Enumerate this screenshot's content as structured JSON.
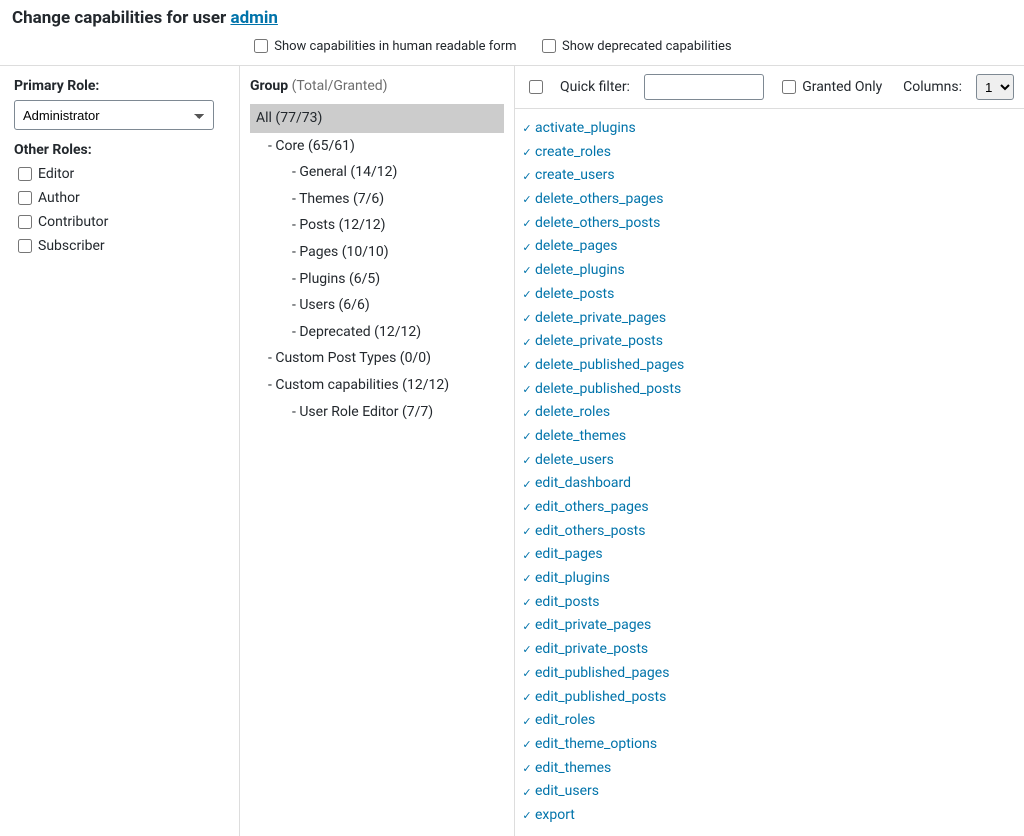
{
  "header": {
    "prefix": "Change capabilities for user ",
    "user": "admin"
  },
  "options": {
    "human_readable": "Show capabilities in human readable form",
    "show_deprecated": "Show deprecated capabilities"
  },
  "left": {
    "primary_role_label": "Primary Role:",
    "primary_role_value": "Administrator",
    "other_roles_label": "Other Roles:",
    "other_roles": [
      "Editor",
      "Author",
      "Contributor",
      "Subscriber"
    ]
  },
  "mid": {
    "group_label": "Group",
    "group_sub": "(Total/Granted)",
    "tree": {
      "all": "All (77/73)",
      "l1": [
        {
          "label": "- Core (65/61)",
          "children": [
            "- General (14/12)",
            "- Themes (7/6)",
            "- Posts (12/12)",
            "- Pages (10/10)",
            "- Plugins (6/5)",
            "- Users (6/6)",
            "- Deprecated (12/12)"
          ]
        },
        {
          "label": "- Custom Post Types (0/0)",
          "children": []
        },
        {
          "label": "- Custom capabilities (12/12)",
          "children": [
            "- User Role Editor (7/7)"
          ]
        }
      ]
    }
  },
  "right": {
    "quick_filter_label": "Quick filter:",
    "quick_filter_value": "",
    "granted_only_label": "Granted Only",
    "columns_label": "Columns:",
    "columns_value": "1",
    "caps": [
      "activate_plugins",
      "create_roles",
      "create_users",
      "delete_others_pages",
      "delete_others_posts",
      "delete_pages",
      "delete_plugins",
      "delete_posts",
      "delete_private_pages",
      "delete_private_posts",
      "delete_published_pages",
      "delete_published_posts",
      "delete_roles",
      "delete_themes",
      "delete_users",
      "edit_dashboard",
      "edit_others_pages",
      "edit_others_posts",
      "edit_pages",
      "edit_plugins",
      "edit_posts",
      "edit_private_pages",
      "edit_private_posts",
      "edit_published_pages",
      "edit_published_posts",
      "edit_roles",
      "edit_theme_options",
      "edit_themes",
      "edit_users",
      "export"
    ]
  }
}
